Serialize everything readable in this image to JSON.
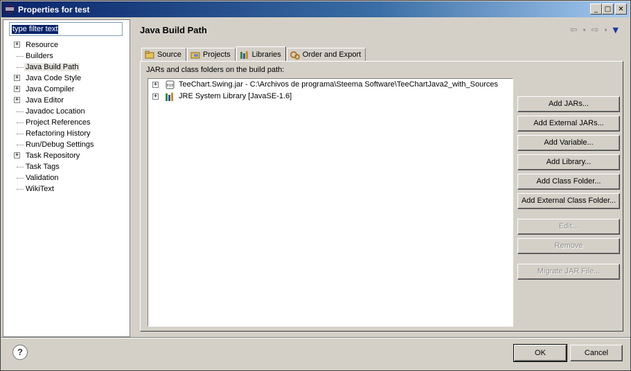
{
  "window": {
    "title": "Properties for test"
  },
  "filter": {
    "placeholder": "type filter text"
  },
  "tree": [
    {
      "label": "Resource",
      "expandable": true
    },
    {
      "label": "Builders",
      "expandable": false
    },
    {
      "label": "Java Build Path",
      "expandable": false,
      "selected": true
    },
    {
      "label": "Java Code Style",
      "expandable": true
    },
    {
      "label": "Java Compiler",
      "expandable": true
    },
    {
      "label": "Java Editor",
      "expandable": true
    },
    {
      "label": "Javadoc Location",
      "expandable": false
    },
    {
      "label": "Project References",
      "expandable": false
    },
    {
      "label": "Refactoring History",
      "expandable": false
    },
    {
      "label": "Run/Debug Settings",
      "expandable": false
    },
    {
      "label": "Task Repository",
      "expandable": true
    },
    {
      "label": "Task Tags",
      "expandable": false
    },
    {
      "label": "Validation",
      "expandable": false
    },
    {
      "label": "WikiText",
      "expandable": false
    }
  ],
  "page": {
    "title": "Java Build Path"
  },
  "tabs": [
    {
      "label": "Source",
      "icon": "source-folder-icon"
    },
    {
      "label": "Projects",
      "icon": "projects-icon"
    },
    {
      "label": "Libraries",
      "icon": "libraries-icon",
      "active": true
    },
    {
      "label": "Order and Export",
      "icon": "order-export-icon"
    }
  ],
  "libraries": {
    "caption": "JARs and class folders on the build path:",
    "entries": [
      {
        "label": "TeeChart.Swing.jar - C:\\Archivos de programa\\Steema Software\\TeeChartJava2_with_Sources",
        "icon": "jar-icon"
      },
      {
        "label": "JRE System Library [JavaSE-1.6]",
        "icon": "library-icon"
      }
    ]
  },
  "buttons": [
    {
      "label": "Add JARs...",
      "enabled": true
    },
    {
      "label": "Add External JARs...",
      "enabled": true
    },
    {
      "label": "Add Variable...",
      "enabled": true
    },
    {
      "label": "Add Library...",
      "enabled": true
    },
    {
      "label": "Add Class Folder...",
      "enabled": true
    },
    {
      "label": "Add External Class Folder...",
      "enabled": true
    },
    {
      "label": "Edit...",
      "enabled": false
    },
    {
      "label": "Remove",
      "enabled": false
    },
    {
      "label": "Migrate JAR File...",
      "enabled": false
    }
  ],
  "footer": {
    "ok_label": "OK",
    "cancel_label": "Cancel",
    "help_glyph": "?"
  }
}
